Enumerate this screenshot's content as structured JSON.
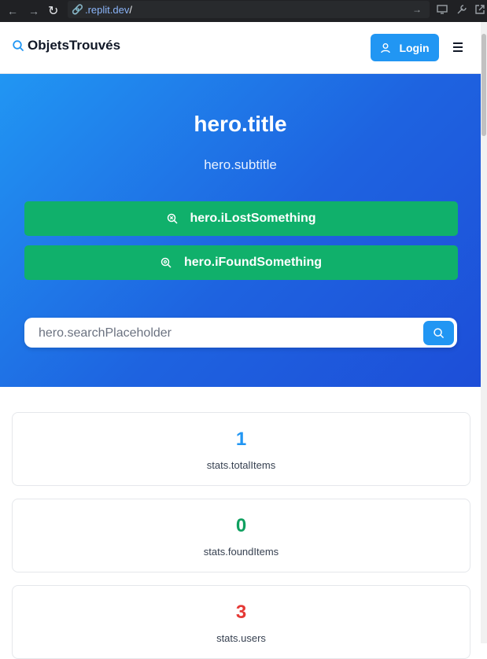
{
  "browser": {
    "url_prefix": ".replit.dev",
    "url_suffix": "/"
  },
  "header": {
    "brand": "ObjetsTrouvés",
    "login_label": "Login"
  },
  "hero": {
    "title": "hero.title",
    "subtitle": "hero.subtitle",
    "lost_label": "hero.iLostSomething",
    "found_label": "hero.iFoundSomething",
    "search_placeholder": "hero.searchPlaceholder"
  },
  "stats": [
    {
      "value": "1",
      "label": "stats.totalItems",
      "color": "#2196f3"
    },
    {
      "value": "0",
      "label": "stats.foundItems",
      "color": "#10a060"
    },
    {
      "value": "3",
      "label": "stats.users",
      "color": "#e53935"
    }
  ],
  "colors": {
    "primary": "#2196f3",
    "success": "#10b06b",
    "hero_gradient_end": "#1d4ed8"
  }
}
